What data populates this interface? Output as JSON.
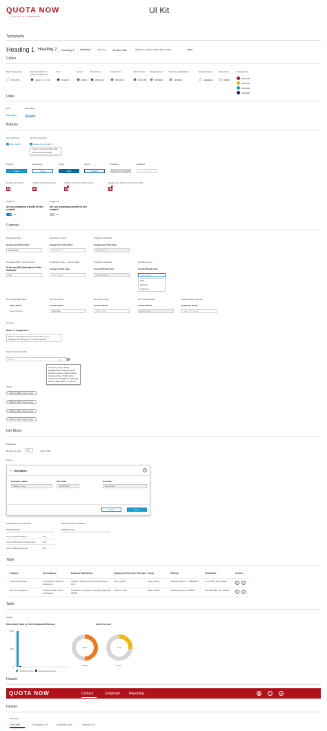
{
  "header": {
    "logo": "QUOTA NOW",
    "tagline": "A NICE IT COMPANY",
    "title": "UI Kit"
  },
  "sections": {
    "typography": "Typography",
    "colors": "Colors",
    "links": "Links",
    "buttons": "Buttons",
    "controls": "Controls",
    "info_block": "Info Block",
    "table1": "Table",
    "table2": "Table",
    "header1": "Header",
    "header2": "Header"
  },
  "typography": {
    "h1": "Heading 1",
    "h2": "Heading 2",
    "h3": "Heading 3",
    "h4": "Heading 4",
    "misc": "Nav root",
    "section": "Section title",
    "sap": "SAP form, section subtitle, table header",
    "label": "Label"
  },
  "colors": [
    {
      "name": "Main background",
      "hex": "#FFFFFF",
      "color": "#ffffff"
    },
    {
      "name": "Heading banner & popup background",
      "hex": "rgba(0, 0, 0, 0.6)",
      "color": "#3a3a3a"
    },
    {
      "name": "Text",
      "hex": "#333333",
      "color": "#333333"
    },
    {
      "name": "Accent",
      "hex": "#0081",
      "color": "#0a6aa0"
    },
    {
      "name": "Red accent",
      "hex": "#B0121B",
      "color": "#b0121b"
    },
    {
      "name": "Link, button",
      "hex": "#0064A8",
      "color": "#0a84c6"
    },
    {
      "name": "Active button",
      "hex": "#007AB8",
      "color": "#0a6aa0"
    },
    {
      "name": "Orange accent",
      "hex": "#E56B00",
      "color": "#e56b00"
    },
    {
      "name": "Borders, placeholders",
      "hex": "#999999",
      "color": "#999999"
    },
    {
      "name": "Disabled input",
      "hex": "#EEEEEE",
      "color": "#eeeeee"
    },
    {
      "name": "Watermark",
      "hex": "#E5E5",
      "color": "#e5e5e5"
    }
  ],
  "infographics": {
    "label": "Infographics",
    "items": [
      "#B0121B",
      "#FFA500",
      "#00A0E0",
      "#1B1E50"
    ],
    "colors": [
      "#b0121b",
      "#ffa500",
      "#00a0e0",
      "#1b1e50"
    ]
  },
  "links": {
    "link": "Link",
    "link_hover": "Link Hover",
    "link_text": "Add project",
    "link_hover_text": "Add project"
  },
  "buttons": {
    "icon_left": "Icon-left button",
    "icon_dropdown": "Icon-link dropdown",
    "add_product": "Add product",
    "create_new": "Create new contact",
    "menu": [
      "Create contact using SAP profile",
      "Create contact w/o profile"
    ],
    "primary": "Primary",
    "secondary": "Secondary",
    "active": "Active",
    "active2": "Active",
    "disabled": "Disabled",
    "disabled2": "Disabled",
    "btn_save": "Save",
    "btn_cancel": "Cancel",
    "btn_save2": "Save",
    "btn_cancel2": "Cancel",
    "btn_save3": "Save",
    "btn_cancel3": "Cancel",
    "hdr_icon": "Header icon button",
    "hdr_icon_active": "Header icon button active",
    "hdr_icon_counter": "Header icon button with counter",
    "hdr_icon_counter_active": "Header icon button with counter active",
    "toggle_on": "Toggle on",
    "toggle_off": "Toggle off",
    "toggle_q": "Are you requesting a profile for this contact?",
    "toggle_q2": "Are you requesting a profile for this contact?",
    "yes": "Yes",
    "no": "No"
  },
  "controls": {
    "dp_filled": "Datepicker filled",
    "dp_empty": "Datepicker empty",
    "dp_disabled": "Datepicker disabled",
    "eng_start": "Engagement Start Date:",
    "date_val": "12/09/2019",
    "date_ph": "MM/DD/YYYY",
    "dd_filled": "Dropdown filled - two-line label",
    "dd_empty": "Dropdown empty - one-line label",
    "dd_disabled": "Dropdown disabled",
    "dd_open": "Dropdown open",
    "apc_q": "Is this an APC (Alternative Profile Contact)?",
    "yes": "Yes",
    "cpt": "Contact Profile Type",
    "select": "Select value",
    "dd_options": [
      "SAP",
      "External",
      "Unknown"
    ],
    "text_filled_value": "Text inside filled value",
    "text_filled": "Text input filled",
    "text_empty": "Text input empty",
    "text_disabled": "Text input disabled",
    "people_picker": "People picker required",
    "client_name": "Client Name",
    "client_val": "Nike Industries",
    "contact_name": "Contact Name",
    "contact_val": "John Doe",
    "enter_value": "Enter value",
    "emp_name": "Employee Name:",
    "search_ph": "Search by name",
    "textarea": "Textarea",
    "nature": "Nature of Engagement:",
    "nature_val": "Nature of Engagement should be filled by an Engagement Manager or an Administrator",
    "search_tooltip": "Search with info tooltip",
    "search_ph2": "Search",
    "tooltip": "Search by Name, Status, Engagements ID, Employee ID, Employee Name, Position Name, Employee Type, Profile Name, Profile Type, Engagement Manager Name, Leader Name, or SAP ID",
    "tooltip_label": "Tooltip",
    "tips": [
      "What is GBF? (upon view)",
      "What is GBF? (upon view)",
      "What is GBF? (upon view)",
      "What is GBF? (upon view)"
    ]
  },
  "info": {
    "pagination": "Pagination",
    "results": "Results on page:",
    "per_page": "20",
    "range": "1-20 of 500",
    "popup": "Popup",
    "popup_title": "Delegates",
    "cols": [
      "Delegate's Name",
      "Start Date",
      "End Date"
    ],
    "vals": [
      "Brooke, Tony",
      "12/09/2019",
      "09/12/2019"
    ],
    "cancel": "Cancel",
    "save": "Save",
    "collapse_exp": "Collapsible pane expanded",
    "collapse_col": "Collapsible pane collapsed",
    "total": "Total Expenses",
    "total2": "Total Expenses",
    "rows": [
      [
        "Cost of Subcontractors",
        "N/A"
      ],
      [
        "Cost of Member-firm Resources",
        "N/A"
      ],
      [
        "Cost of Other Expenses",
        "N/A"
      ]
    ]
  },
  "table": {
    "headers": [
      "Category",
      "Sub-Category",
      "Employer Subdivision",
      "Employee Profile Type (if known)",
      "Group",
      "Offering",
      "Code Name",
      "Actions"
    ],
    "rows": [
      [
        "Full-time Employees",
        "Administrative Staff (non-productive)",
        "Analytics, Modeling, and Financial Advisory - 1234",
        "SAP - @ABCI",
        "M&A - Politics",
        "Strategic Advisory - 7788995330",
        "IC-0176451, AD-7789930",
        ""
      ],
      [
        "Part-time Employees",
        "Production staff (current employees)",
        "Transaction, execution, Accounting, Reporting - 987654",
        "External - 2536",
        "M&A - EXTRA",
        "Creative Services - 6789555",
        "MC-78375598, AD-7789590",
        ""
      ]
    ]
  },
  "charts": {
    "assets": "Assets",
    "chart1_title": "Opportunity Value vs. Total Engagement Revenue",
    "chart2_title": "Hours by Level",
    "legend1": "Opportunity Value",
    "legend2": "Engagement Revenue",
    "y_ticks": [
      "1000",
      "500",
      "0"
    ],
    "donut1_label": "50%",
    "donut2_label": "27%",
    "donut1_sub": "Dr.Mgr",
    "donut2_sub": "Contr"
  },
  "chart_data": [
    {
      "type": "bar",
      "title": "Opportunity Value vs. Total Engagement Revenue",
      "categories": [
        ""
      ],
      "series": [
        {
          "name": "Opportunity Value",
          "values": [
            1000
          ]
        },
        {
          "name": "Engagement Revenue",
          "values": [
            20
          ]
        }
      ],
      "ylim": [
        0,
        1000
      ]
    },
    {
      "type": "pie",
      "title": "Hours by Level",
      "categories": [
        "Dr.Mgr",
        "rest"
      ],
      "values": [
        50,
        50
      ]
    },
    {
      "type": "pie",
      "title": "Hours by Level",
      "categories": [
        "Contr",
        "rest"
      ],
      "values": [
        27,
        73
      ]
    }
  ],
  "nav": {
    "logo": "QUOTA NOW",
    "items": [
      "Contact",
      "Employer",
      "Reporting"
    ],
    "summary": "Summary",
    "tabs": [
      "To Do",
      "In Progress",
      "Completed",
      "Rejected"
    ],
    "counts": [
      "(44)",
      "(33)",
      "(155)",
      "(14)"
    ]
  }
}
